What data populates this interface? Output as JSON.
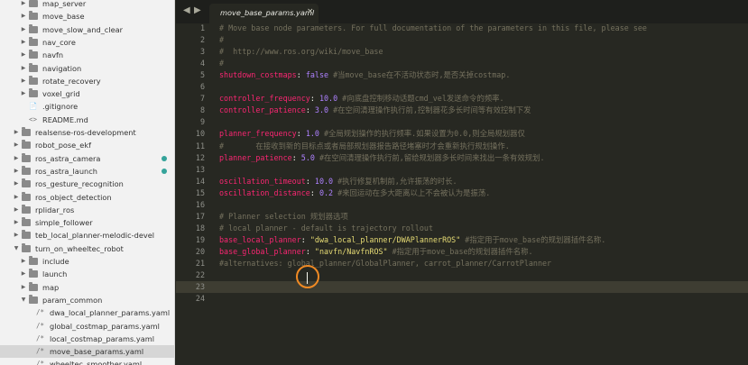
{
  "sidebar": {
    "items": [
      {
        "label": "map_server",
        "depth": 2,
        "kind": "folder",
        "expanded": false
      },
      {
        "label": "move_base",
        "depth": 2,
        "kind": "folder",
        "expanded": false
      },
      {
        "label": "move_slow_and_clear",
        "depth": 2,
        "kind": "folder",
        "expanded": false
      },
      {
        "label": "nav_core",
        "depth": 2,
        "kind": "folder",
        "expanded": false
      },
      {
        "label": "navfn",
        "depth": 2,
        "kind": "folder",
        "expanded": false
      },
      {
        "label": "navigation",
        "depth": 2,
        "kind": "folder",
        "expanded": false
      },
      {
        "label": "rotate_recovery",
        "depth": 2,
        "kind": "folder",
        "expanded": false
      },
      {
        "label": "voxel_grid",
        "depth": 2,
        "kind": "folder",
        "expanded": false
      },
      {
        "label": ".gitignore",
        "depth": 2,
        "kind": "file",
        "glyph": "📄"
      },
      {
        "label": "README.md",
        "depth": 2,
        "kind": "file",
        "glyph": "<>"
      },
      {
        "label": "realsense-ros-development",
        "depth": 1,
        "kind": "folder",
        "expanded": false
      },
      {
        "label": "robot_pose_ekf",
        "depth": 1,
        "kind": "folder",
        "expanded": false
      },
      {
        "label": "ros_astra_camera",
        "depth": 1,
        "kind": "folder",
        "expanded": false,
        "dot": true
      },
      {
        "label": "ros_astra_launch",
        "depth": 1,
        "kind": "folder",
        "expanded": false,
        "dot": true
      },
      {
        "label": "ros_gesture_recognition",
        "depth": 1,
        "kind": "folder",
        "expanded": false
      },
      {
        "label": "ros_object_detection",
        "depth": 1,
        "kind": "folder",
        "expanded": false
      },
      {
        "label": "rplidar_ros",
        "depth": 1,
        "kind": "folder",
        "expanded": false
      },
      {
        "label": "simple_follower",
        "depth": 1,
        "kind": "folder",
        "expanded": false
      },
      {
        "label": "teb_local_planner-melodic-devel",
        "depth": 1,
        "kind": "folder",
        "expanded": false
      },
      {
        "label": "turn_on_wheeltec_robot",
        "depth": 1,
        "kind": "folder",
        "expanded": true
      },
      {
        "label": "include",
        "depth": 2,
        "kind": "folder",
        "expanded": false
      },
      {
        "label": "launch",
        "depth": 2,
        "kind": "folder",
        "expanded": false
      },
      {
        "label": "map",
        "depth": 2,
        "kind": "folder",
        "expanded": false
      },
      {
        "label": "param_common",
        "depth": 2,
        "kind": "folder",
        "expanded": true
      },
      {
        "label": "dwa_local_planner_params.yaml",
        "depth": 3,
        "kind": "file",
        "glyph": "/*"
      },
      {
        "label": "global_costmap_params.yaml",
        "depth": 3,
        "kind": "file",
        "glyph": "/*"
      },
      {
        "label": "local_costmap_params.yaml",
        "depth": 3,
        "kind": "file",
        "glyph": "/*"
      },
      {
        "label": "move_base_params.yaml",
        "depth": 3,
        "kind": "file",
        "glyph": "/*",
        "selected": true
      },
      {
        "label": "wheeltec_smoother.yaml",
        "depth": 3,
        "kind": "file",
        "glyph": "/*"
      }
    ]
  },
  "tabbar": {
    "active_tab": "move_base_params.yaml",
    "close_glyph": "×",
    "nav_left": "◀",
    "nav_right": "▶"
  },
  "editor": {
    "lines": [
      [
        {
          "t": "# Move base node parameters. For full documentation of the parameters in this file, please see",
          "c": "comment"
        }
      ],
      [
        {
          "t": "#",
          "c": "comment"
        }
      ],
      [
        {
          "t": "#  http://www.ros.org/wiki/move_base",
          "c": "comment"
        }
      ],
      [
        {
          "t": "#",
          "c": "comment"
        }
      ],
      [
        {
          "t": "shutdown_costmaps",
          "c": "key"
        },
        {
          "t": ": ",
          "c": "plain"
        },
        {
          "t": "false",
          "c": "const"
        },
        {
          "t": " #当move_base在不活动状态时,是否关掉costmap.",
          "c": "comment"
        }
      ],
      [],
      [
        {
          "t": "controller_frequency",
          "c": "key"
        },
        {
          "t": ": ",
          "c": "plain"
        },
        {
          "t": "10.0",
          "c": "num"
        },
        {
          "t": " #向底盘控制移动话题cmd_vel发送命令的频率.",
          "c": "comment"
        }
      ],
      [
        {
          "t": "controller_patience",
          "c": "key"
        },
        {
          "t": ": ",
          "c": "plain"
        },
        {
          "t": "3.0",
          "c": "num"
        },
        {
          "t": " #在空间清理操作执行前,控制器花多长时间等有效控制下发",
          "c": "comment"
        }
      ],
      [],
      [
        {
          "t": "planner_frequency",
          "c": "key"
        },
        {
          "t": ": ",
          "c": "plain"
        },
        {
          "t": "1.0",
          "c": "num"
        },
        {
          "t": " #全局规划操作的执行频率.如果设置为0.0,则全局规划器仅",
          "c": "comment"
        }
      ],
      [
        {
          "t": "#       在接收到新的目标点或者局部规划器报告路径堵塞时才会重新执行规划操作.",
          "c": "comment"
        }
      ],
      [
        {
          "t": "planner_patience",
          "c": "key"
        },
        {
          "t": ": ",
          "c": "plain"
        },
        {
          "t": "5.0",
          "c": "num"
        },
        {
          "t": " #在空间清理操作执行前,留给规划器多长时间来找出一条有效规划.",
          "c": "comment"
        }
      ],
      [],
      [
        {
          "t": "oscillation_timeout",
          "c": "key"
        },
        {
          "t": ": ",
          "c": "plain"
        },
        {
          "t": "10.0",
          "c": "num"
        },
        {
          "t": " #执行修复机制前,允许振荡的时长.",
          "c": "comment"
        }
      ],
      [
        {
          "t": "oscillation_distance",
          "c": "key"
        },
        {
          "t": ": ",
          "c": "plain"
        },
        {
          "t": "0.2",
          "c": "num"
        },
        {
          "t": " #来回运动在多大距离以上不会被认为是振荡.",
          "c": "comment"
        }
      ],
      [],
      [
        {
          "t": "# Planner selection 规划器选项",
          "c": "comment"
        }
      ],
      [
        {
          "t": "# local planner - default is trajectory rollout",
          "c": "comment"
        }
      ],
      [
        {
          "t": "base_local_planner",
          "c": "key"
        },
        {
          "t": ": ",
          "c": "plain"
        },
        {
          "t": "\"dwa_local_planner/DWAPlannerROS\"",
          "c": "str"
        },
        {
          "t": " #指定用于move_base的规划器插件名称.",
          "c": "comment"
        }
      ],
      [
        {
          "t": "base_global_planner",
          "c": "key"
        },
        {
          "t": ": ",
          "c": "plain"
        },
        {
          "t": "\"navfn/NavfnROS\"",
          "c": "str"
        },
        {
          "t": " #指定用于move_base的规划器插件名称.",
          "c": "comment"
        }
      ],
      [
        {
          "t": "#alternatives: global_planner/GlobalPlanner, carrot_planner/CarrotPlanner",
          "c": "comment"
        }
      ],
      [],
      [],
      []
    ],
    "active_line": 23,
    "colors": {
      "background": "#272822",
      "key": "#f92672",
      "number": "#ae81ff",
      "string": "#e6db74",
      "comment": "#75715e"
    }
  }
}
